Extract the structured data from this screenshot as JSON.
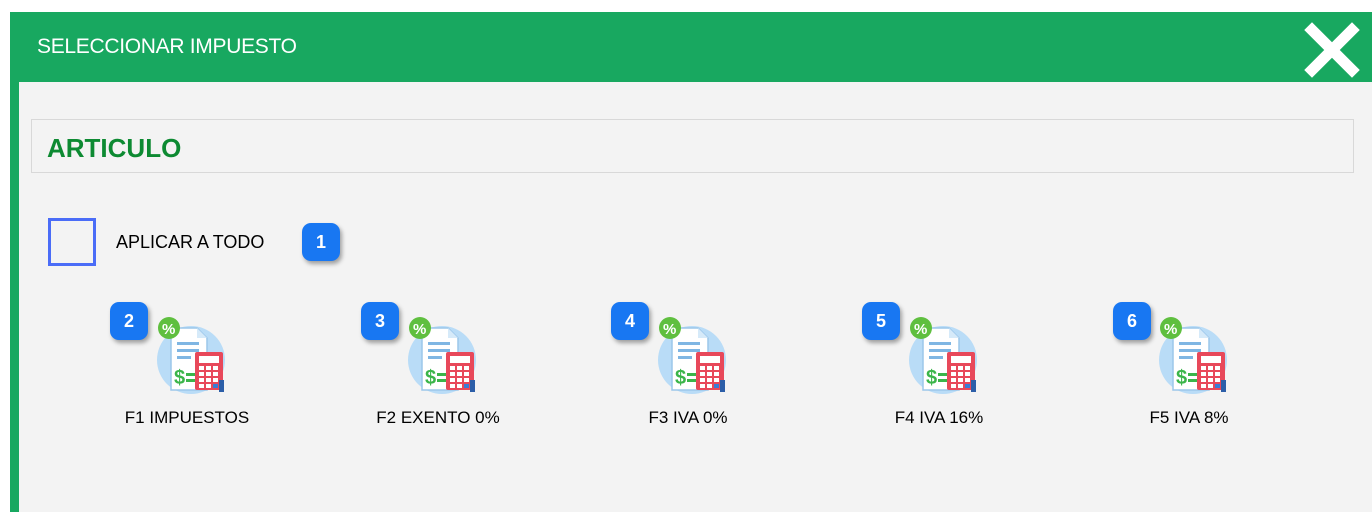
{
  "window": {
    "title": "SELECCIONAR IMPUESTO"
  },
  "section": {
    "title": "ARTICULO"
  },
  "apply_all": {
    "label": "APLICAR A TODO",
    "checked": false,
    "badge": "1"
  },
  "taxes": [
    {
      "label": "F1 IMPUESTOS",
      "badge": "2"
    },
    {
      "label": "F2 EXENTO 0%",
      "badge": "3"
    },
    {
      "label": "F3 IVA 0%",
      "badge": "4"
    },
    {
      "label": "F4 IVA 16%",
      "badge": "5"
    },
    {
      "label": "F5 IVA 8%",
      "badge": "6"
    }
  ],
  "colors": {
    "titlebar": "#18a860",
    "section_title": "#0d8a32",
    "badge": "#1877f2",
    "checkbox_border": "#4a6cf7"
  },
  "icons": {
    "close": "close-icon",
    "tax": "tax-calculator-icon"
  }
}
